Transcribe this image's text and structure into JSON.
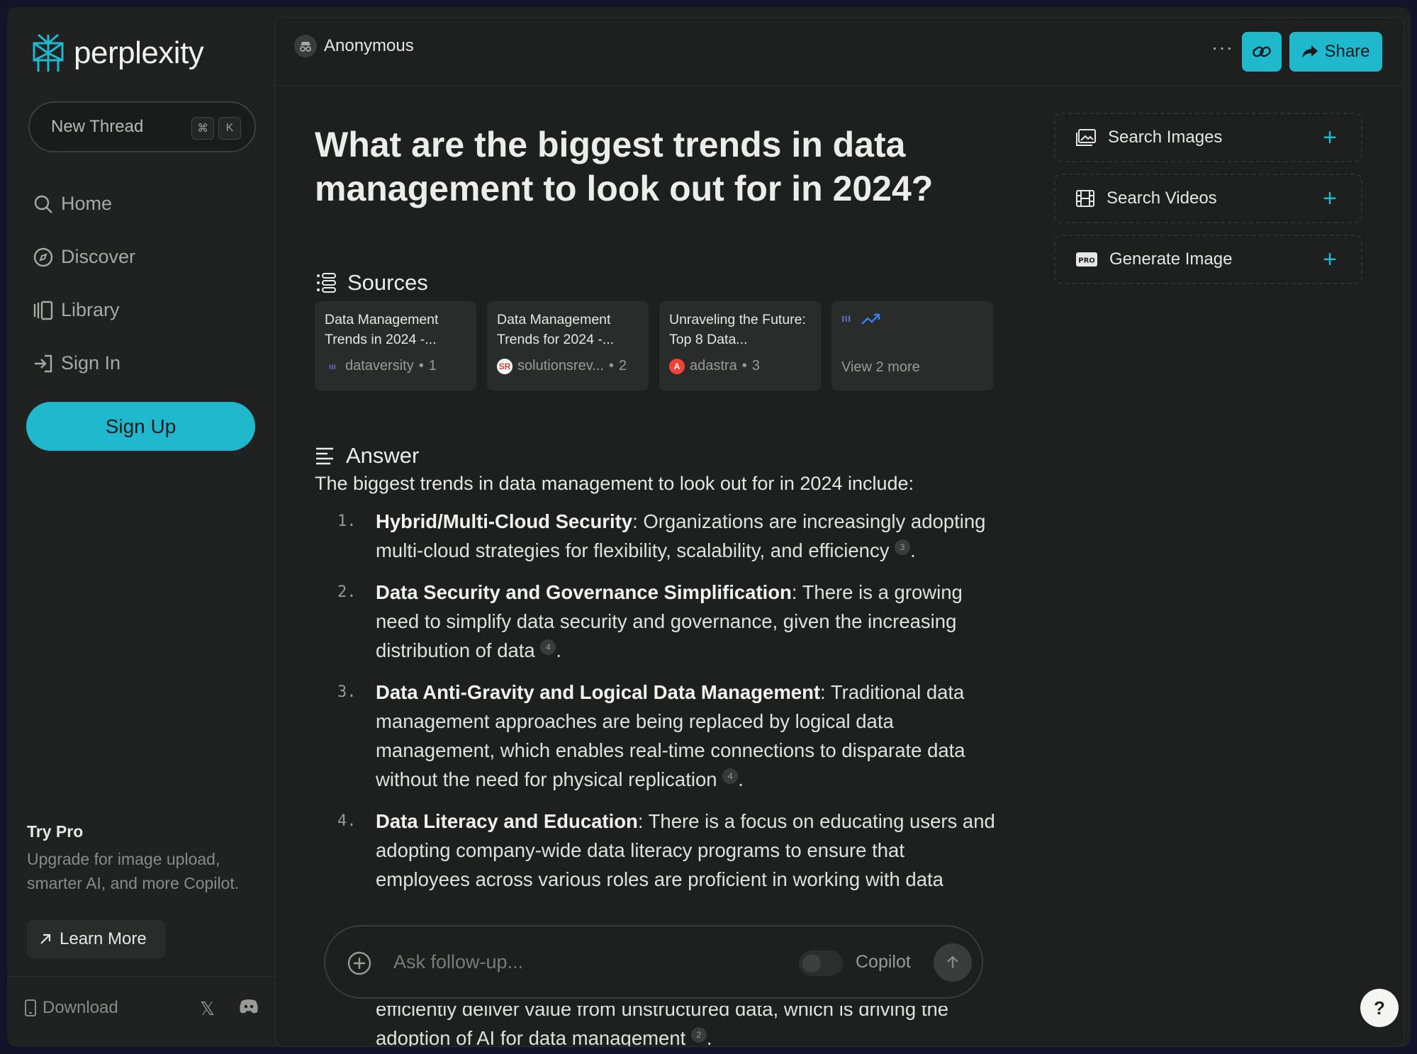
{
  "brand": {
    "name": "perplexity",
    "accent": "#20b8cd"
  },
  "sidebar": {
    "new_thread": {
      "label": "New Thread",
      "shortcut_keys": [
        "⌘",
        "K"
      ]
    },
    "nav": [
      {
        "label": "Home",
        "icon": "search-icon"
      },
      {
        "label": "Discover",
        "icon": "compass-icon"
      },
      {
        "label": "Library",
        "icon": "library-icon"
      },
      {
        "label": "Sign In",
        "icon": "sign-in-icon"
      }
    ],
    "signup_label": "Sign Up",
    "try_pro": {
      "title": "Try Pro",
      "description": "Upgrade for image upload, smarter AI, and more Copilot.",
      "learn_more": "Learn More"
    },
    "footer": {
      "download": "Download"
    }
  },
  "topbar": {
    "user": "Anonymous",
    "more": "···",
    "share_label": "Share"
  },
  "thread": {
    "question": "What are the biggest trends in data management to look out for in 2024?",
    "sources_heading": "Sources",
    "sources": [
      {
        "title": "Data Management Trends in 2024 -...",
        "site": "dataversity",
        "index": "1",
        "favicon_color": "#3f51b5",
        "favicon_text": "ııı"
      },
      {
        "title": "Data Management Trends for 2024 -...",
        "site": "solutionsrev...",
        "index": "2",
        "favicon_color": "#e53935",
        "favicon_text": "SR"
      },
      {
        "title": "Unraveling the Future: Top 8 Data...",
        "site": "adastra",
        "index": "3",
        "favicon_color": "#f44336",
        "favicon_text": "A"
      }
    ],
    "view_more": "View 2 more",
    "answer_heading": "Answer",
    "answer_intro": "The biggest trends in data management to look out for in 2024 include:",
    "answer_items": [
      {
        "num": "1.",
        "title": "Hybrid/Multi-Cloud Security",
        "text": ": Organizations are increasingly adopting multi-cloud strategies for flexibility, scalability, and efficiency",
        "cite": "3"
      },
      {
        "num": "2.",
        "title": "Data Security and Governance Simplification",
        "text": ": There is a growing need to simplify data security and governance, given the increasing distribution of data",
        "cite": "4"
      },
      {
        "num": "3.",
        "title": "Data Anti-Gravity and Logical Data Management",
        "text": ": Traditional data management approaches are being replaced by logical data management, which enables real-time connections to disparate data without the need for physical replication",
        "cite": "4"
      },
      {
        "num": "4.",
        "title": "Data Literacy and Education",
        "text": ": There is a focus on educating users and adopting company-wide data literacy programs to ensure that employees across various roles are proficient in working with data",
        "cite": ""
      }
    ],
    "answer_tail": {
      "text": "efficiently deliver value from unstructured data, which is driving the adoption of AI for data management",
      "cite": "2"
    }
  },
  "followup": {
    "placeholder": "Ask follow-up...",
    "copilot_label": "Copilot"
  },
  "right_panel": [
    {
      "label": "Search Images",
      "icon": "image-icon"
    },
    {
      "label": "Search Videos",
      "icon": "film-icon"
    },
    {
      "label": "Generate Image",
      "icon": "pro-badge-icon"
    }
  ],
  "help_label": "?"
}
